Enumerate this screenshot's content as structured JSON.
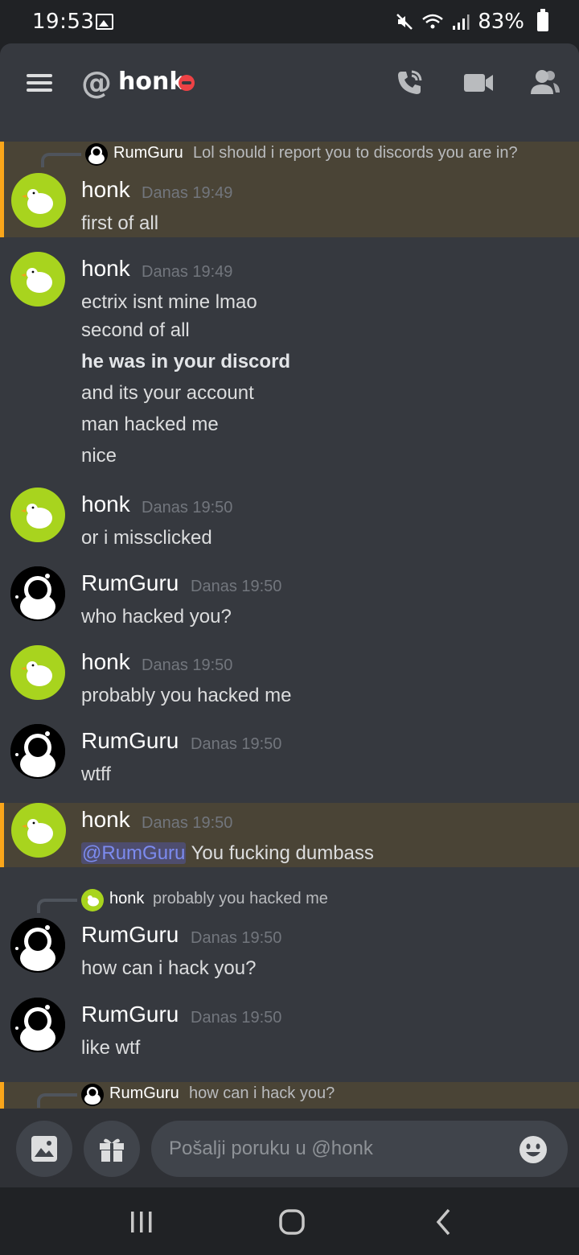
{
  "status_bar": {
    "time": "19:53",
    "battery": "83%"
  },
  "header": {
    "channel_name": "honk"
  },
  "messages": [
    {
      "reply": {
        "name": "RumGuru",
        "text": "Lol  should i report you to discords you are in?"
      },
      "author": "honk",
      "time": "Danas 19:49",
      "lines": [
        "first of all"
      ]
    },
    {
      "author": "honk",
      "time": "Danas 19:49",
      "lines": [
        "ectrix isnt mine lmao",
        "second of all",
        "he was in your discord",
        "and its your account",
        "man hacked me",
        "nice"
      ]
    },
    {
      "author": "honk",
      "time": "Danas 19:50",
      "lines": [
        "or i missclicked"
      ]
    },
    {
      "author": "RumGuru",
      "time": "Danas 19:50",
      "lines": [
        "who hacked you?"
      ]
    },
    {
      "author": "honk",
      "time": "Danas 19:50",
      "lines": [
        "probably you hacked me"
      ]
    },
    {
      "author": "RumGuru",
      "time": "Danas 19:50",
      "lines": [
        "wtff"
      ]
    },
    {
      "author": "honk",
      "time": "Danas 19:50",
      "mention": "@RumGuru",
      "lines": [
        "You fucking dumbass"
      ]
    },
    {
      "reply": {
        "name": "honk",
        "text": "probably you hacked me"
      },
      "author": "RumGuru",
      "time": "Danas 19:50",
      "lines": [
        "how can i hack you?"
      ]
    },
    {
      "author": "RumGuru",
      "time": "Danas 19:50",
      "lines": [
        "like wtf"
      ]
    },
    {
      "reply": {
        "name": "RumGuru",
        "text": "how can i hack you?"
      }
    }
  ],
  "composer": {
    "placeholder": "Pošalji poruku u @honk"
  },
  "icons": {
    "menu": "hamburger-icon",
    "at": "at-icon",
    "call": "phone-call-icon",
    "video": "video-camera-icon",
    "members": "members-icon",
    "image": "image-icon",
    "gift": "gift-icon",
    "emoji": "emoji-icon"
  },
  "colors": {
    "accent_mention": "#faa61a",
    "mention_bg": "#4a4436",
    "dnd": "#ed4245",
    "goose_avatar": "#a8d41e"
  }
}
